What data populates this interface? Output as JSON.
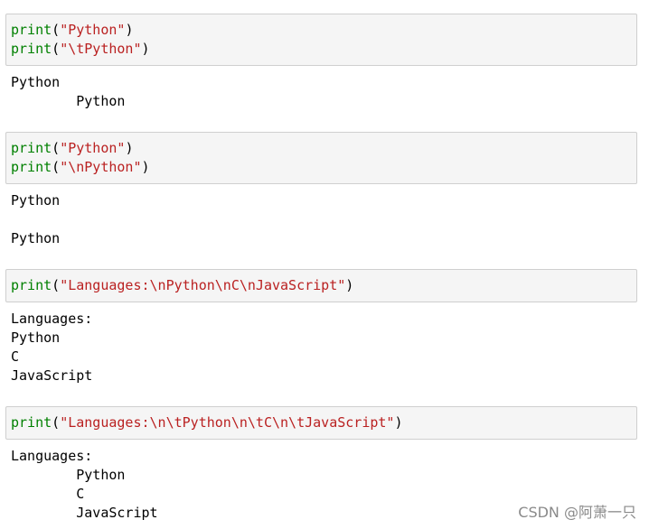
{
  "cells": [
    {
      "input": [
        {
          "fn": "print",
          "open": "(",
          "str": "\"Python\"",
          "close": ")"
        },
        {
          "fn": "print",
          "open": "(",
          "str": "\"\\tPython\"",
          "close": ")"
        }
      ],
      "output": [
        "Python",
        "        Python"
      ]
    },
    {
      "input": [
        {
          "fn": "print",
          "open": "(",
          "str": "\"Python\"",
          "close": ")"
        },
        {
          "fn": "print",
          "open": "(",
          "str": "\"\\nPython\"",
          "close": ")"
        }
      ],
      "output": [
        "Python",
        "",
        "Python"
      ]
    },
    {
      "input": [
        {
          "fn": "print",
          "open": "(",
          "str": "\"Languages:\\nPython\\nC\\nJavaScript\"",
          "close": ")"
        }
      ],
      "output": [
        "Languages:",
        "Python",
        "C",
        "JavaScript"
      ]
    },
    {
      "input": [
        {
          "fn": "print",
          "open": "(",
          "str": "\"Languages:\\n\\tPython\\n\\tC\\n\\tJavaScript\"",
          "close": ")"
        }
      ],
      "output": [
        "Languages:",
        "        Python",
        "        C",
        "        JavaScript"
      ]
    }
  ],
  "watermark": "CSDN @阿萧一只"
}
